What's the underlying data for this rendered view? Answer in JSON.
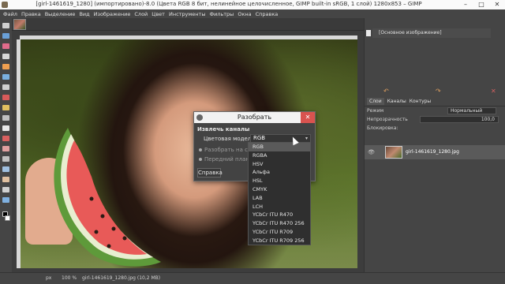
{
  "window": {
    "title": "[girl-1461619_1280] (импортировано)-8.0 (Цвета RGB 8 бит, нелинейное целочисленное, GIMP built-in sRGB, 1 слой) 1280x853 – GIMP",
    "minimize": "–",
    "maximize": "□",
    "close": "✕"
  },
  "menu": [
    "Файл",
    "Правка",
    "Выделение",
    "Вид",
    "Изображение",
    "Слой",
    "Цвет",
    "Инструменты",
    "Фильтры",
    "Окна",
    "Справка"
  ],
  "history": {
    "item": "[Основное изображение]"
  },
  "layers_panel": {
    "tabs": [
      "Слои",
      "Каналы",
      "Контуры"
    ],
    "mode_label": "Режим",
    "mode_value": "Нормальный",
    "opacity_label": "Непрозрачность",
    "opacity_value": "100,0",
    "lock_label": "Блокировка:",
    "layer_name": "girl-1461619_1280.jpg"
  },
  "dialog": {
    "title": "Разобрать",
    "close": "✕",
    "heading": "Извлечь каналы",
    "model_label": "Цветовая модель:",
    "model_value": "RGB",
    "option_layers": "Разобрать на слои",
    "option_fg": "Передний план как",
    "help_button": "Справка"
  },
  "dropdown": {
    "items": [
      "RGB",
      "RGBA",
      "HSV",
      "Альфа",
      "HSL",
      "CMYK",
      "LAB",
      "LCH",
      "YCbCr ITU R470",
      "YCbCr ITU R470 256",
      "YCbCr ITU R709",
      "YCbCr ITU R709 256"
    ],
    "selected": "RGB"
  },
  "statusbar": {
    "unit": "px",
    "zoom": "100 %",
    "file": "girl-1461619_1280.jpg (10,2 МВ)"
  }
}
